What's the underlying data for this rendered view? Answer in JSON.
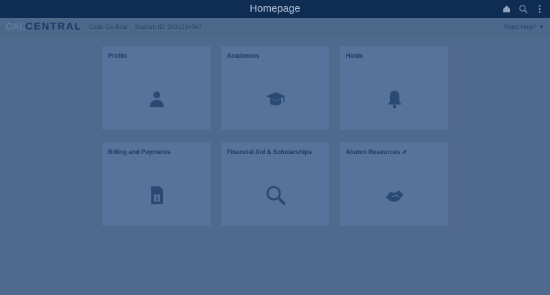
{
  "header": {
    "title": "Homepage",
    "icons": [
      "home-icon",
      "search-icon",
      "more-vertical-icon"
    ]
  },
  "subheader": {
    "logo_cal": "CAL",
    "logo_central": "CENTRAL",
    "welcome": "Cade Go Bear",
    "student_id": "Student ID: 3031234567",
    "need_help": "Need Help? ▼"
  },
  "tiles": [
    {
      "title": "Profile",
      "icon": "person-icon"
    },
    {
      "title": "Academics",
      "icon": "graduation-cap-icon"
    },
    {
      "title": "Holds",
      "icon": "bell-icon"
    },
    {
      "title": "Billing and Payments",
      "icon": "bill-icon"
    },
    {
      "title": "Financial Aid & Scholarships",
      "icon": "magnifier-icon"
    },
    {
      "title": "Alumni Resources ⇗",
      "icon": "handshake-icon"
    }
  ],
  "colors": {
    "topbar": "#0f2d53",
    "overlay_background": "#4f6a8c",
    "tile_background": "#57729b",
    "icon": "#2b4a73"
  }
}
